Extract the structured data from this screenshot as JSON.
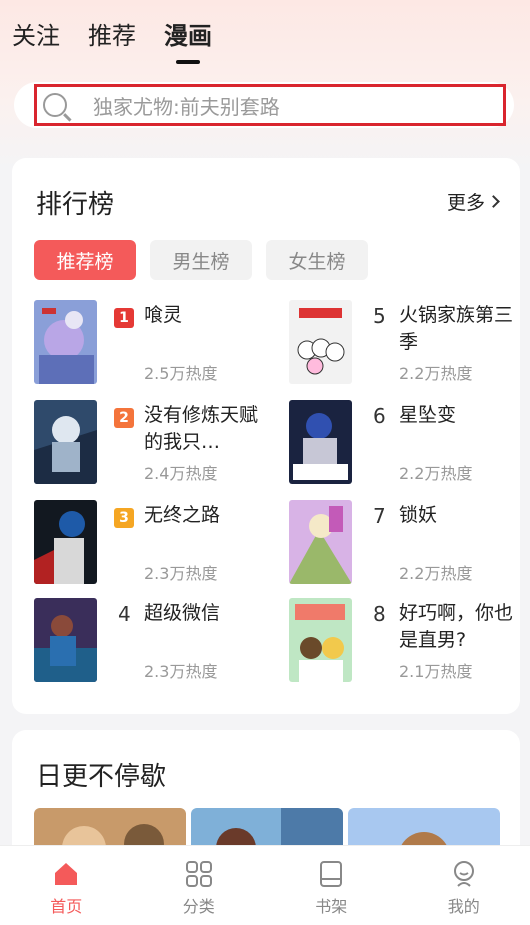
{
  "header": {
    "tabs": [
      {
        "label": "关注"
      },
      {
        "label": "推荐"
      },
      {
        "label": "漫画"
      }
    ],
    "active_tab": "漫画"
  },
  "search": {
    "placeholder": "独家尤物:前夫别套路"
  },
  "ranking": {
    "title": "排行榜",
    "more_label": "更多",
    "tabs": [
      {
        "label": "推荐榜"
      },
      {
        "label": "男生榜"
      },
      {
        "label": "女生榜"
      }
    ],
    "items": [
      {
        "rank": "1",
        "name": "喰灵",
        "heat": "2.5万热度",
        "badge_color": "#e53935"
      },
      {
        "rank": "2",
        "name": "没有修炼天赋的我只…",
        "heat": "2.4万热度",
        "badge_color": "#f4743b"
      },
      {
        "rank": "3",
        "name": "无终之路",
        "heat": "2.3万热度",
        "badge_color": "#f5a623"
      },
      {
        "rank": "4",
        "name": "超级微信",
        "heat": "2.3万热度"
      },
      {
        "rank": "5",
        "name": "火锅家族第三季",
        "heat": "2.2万热度"
      },
      {
        "rank": "6",
        "name": "星坠变",
        "heat": "2.2万热度"
      },
      {
        "rank": "7",
        "name": "锁妖",
        "heat": "2.2万热度"
      },
      {
        "rank": "8",
        "name": "好巧啊，你也是直男?",
        "heat": "2.1万热度"
      }
    ]
  },
  "daily": {
    "title": "日更不停歇"
  },
  "bottom_nav": [
    {
      "label": "首页",
      "icon": "home-icon"
    },
    {
      "label": "分类",
      "icon": "category-icon"
    },
    {
      "label": "书架",
      "icon": "bookshelf-icon"
    },
    {
      "label": "我的",
      "icon": "profile-icon"
    }
  ],
  "colors": {
    "accent": "#f45a5a",
    "search_border": "#d9252e"
  }
}
